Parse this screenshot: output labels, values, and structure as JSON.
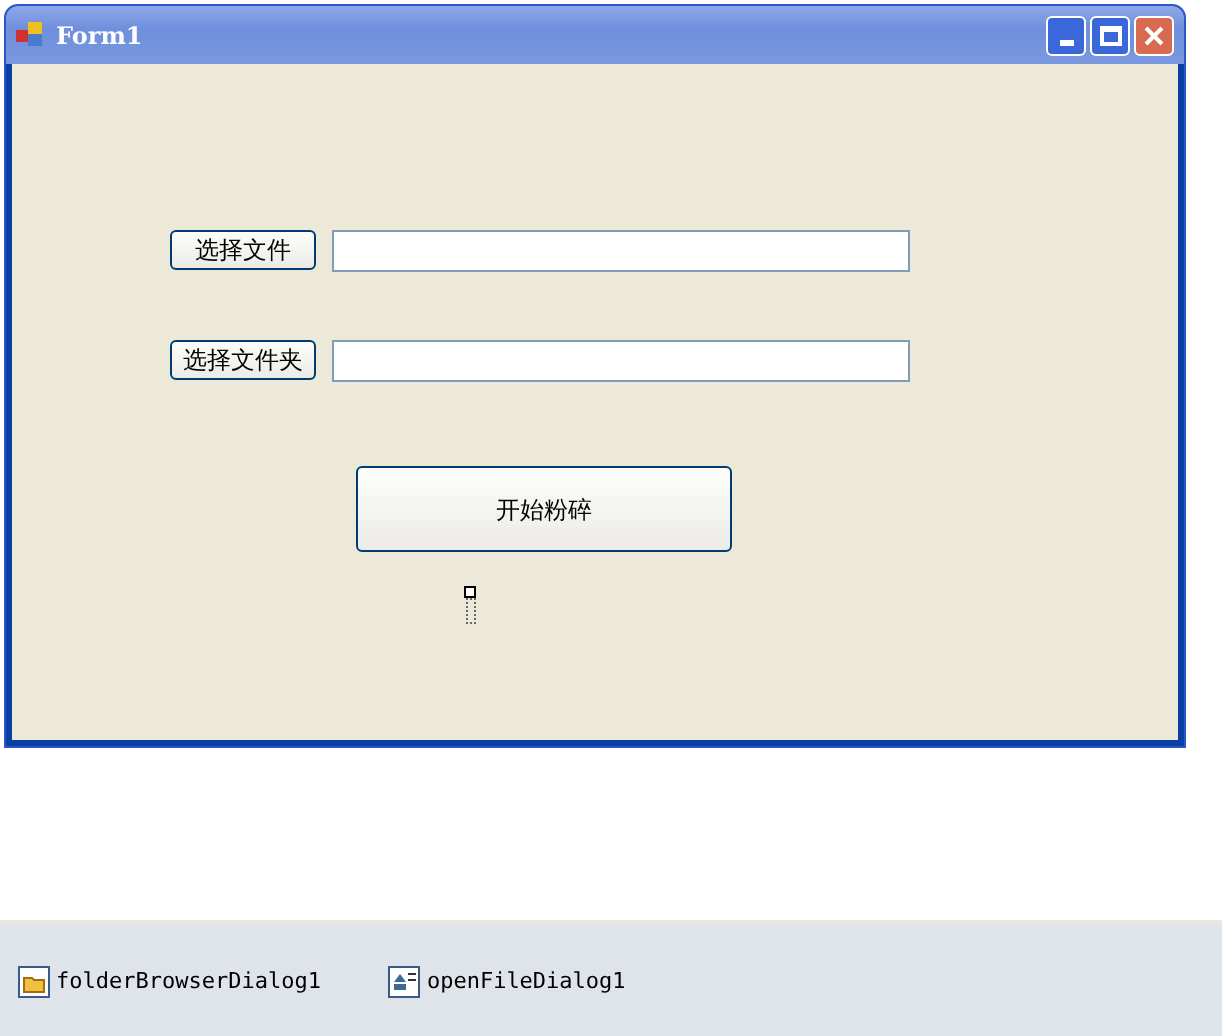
{
  "window": {
    "title": "Form1"
  },
  "form": {
    "buttons": [
      {
        "label": "选择文件"
      },
      {
        "label": "选择文件夹"
      }
    ],
    "start_button": {
      "label": "开始粉碎"
    }
  },
  "component_tray": [
    {
      "kind": "folder",
      "label": "folderBrowserDialog1"
    },
    {
      "kind": "file",
      "label": "openFileDialog1"
    }
  ]
}
